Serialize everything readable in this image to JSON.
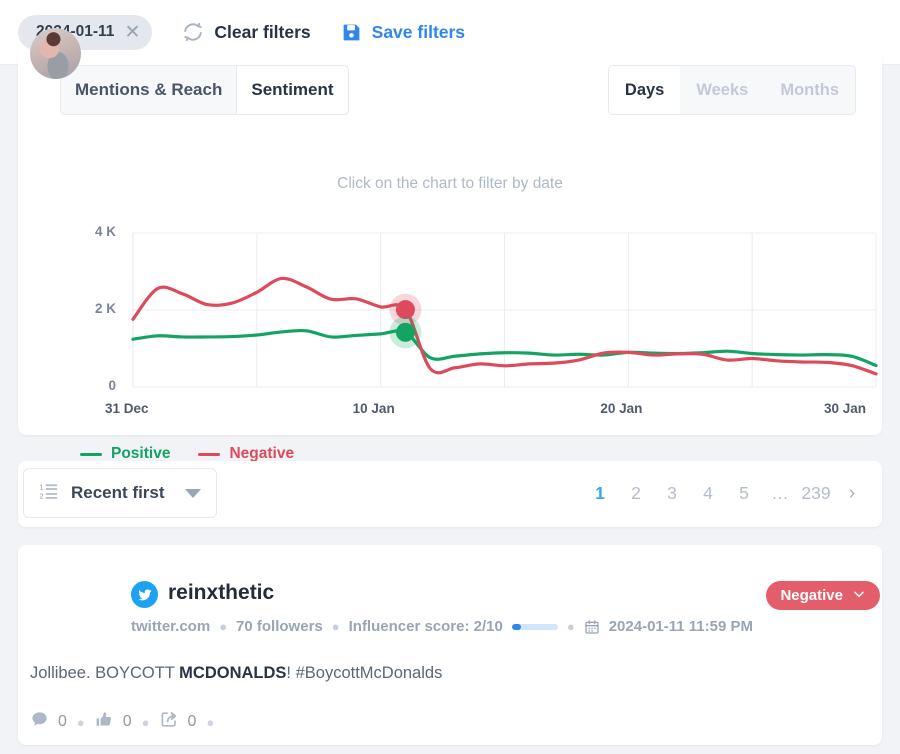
{
  "topbar": {
    "date_chip": "2024-01-11",
    "clear_filters": "Clear filters",
    "save_filters": "Save filters",
    "refresh_icon": "refresh-icon",
    "save_icon": "save-floppy-icon",
    "close_icon": "close-icon"
  },
  "chart_card": {
    "tabs": [
      {
        "label": "Mentions & Reach",
        "active": false
      },
      {
        "label": "Sentiment",
        "active": true
      }
    ],
    "granularity": [
      {
        "label": "Days",
        "active": true
      },
      {
        "label": "Weeks",
        "active": false
      },
      {
        "label": "Months",
        "active": false
      }
    ],
    "hint": "Click on the chart to filter by date"
  },
  "chart_data": {
    "type": "line",
    "title": "",
    "xlabel": "",
    "ylabel": "",
    "ylim": [
      0,
      4000
    ],
    "ytick_labels": [
      "4 K",
      "2 K",
      "0"
    ],
    "ytick_values": [
      4000,
      2000,
      0
    ],
    "xtick_labels": [
      "31 Dec",
      "10 Jan",
      "20 Jan",
      "30 Jan"
    ],
    "xtick_index": [
      0,
      10,
      20,
      30
    ],
    "grid": true,
    "legend_position": "bottom-left",
    "selected_x": "2024-01-11",
    "selected_index": 11,
    "x": [
      "31 Dec",
      "1 Jan",
      "2 Jan",
      "3 Jan",
      "4 Jan",
      "5 Jan",
      "6 Jan",
      "7 Jan",
      "8 Jan",
      "9 Jan",
      "10 Jan",
      "11 Jan",
      "12 Jan",
      "13 Jan",
      "14 Jan",
      "15 Jan",
      "16 Jan",
      "17 Jan",
      "18 Jan",
      "19 Jan",
      "20 Jan",
      "21 Jan",
      "22 Jan",
      "23 Jan",
      "24 Jan",
      "25 Jan",
      "26 Jan",
      "27 Jan",
      "28 Jan",
      "29 Jan",
      "30 Jan"
    ],
    "series": [
      {
        "name": "Positive",
        "color": "#13a463",
        "values": [
          1240,
          1330,
          1300,
          1300,
          1310,
          1350,
          1430,
          1460,
          1300,
          1340,
          1380,
          1420,
          760,
          800,
          860,
          890,
          880,
          830,
          850,
          830,
          900,
          880,
          870,
          890,
          930,
          870,
          840,
          830,
          840,
          800,
          560
        ]
      },
      {
        "name": "Negative",
        "color": "#dc4a5c",
        "values": [
          1760,
          2560,
          2420,
          2140,
          2180,
          2460,
          2820,
          2600,
          2280,
          2290,
          2080,
          2010,
          480,
          500,
          600,
          550,
          600,
          620,
          700,
          880,
          900,
          830,
          860,
          850,
          700,
          740,
          680,
          650,
          640,
          560,
          340
        ]
      }
    ],
    "markers": [
      {
        "series": "Negative",
        "x": "11 Jan",
        "y": 2010,
        "color": "#dc4a5c"
      },
      {
        "series": "Positive",
        "x": "11 Jan",
        "y": 1420,
        "color": "#13a463"
      }
    ]
  },
  "list_toolbar": {
    "sort_label": "Recent first",
    "sort_icon": "sort-list-icon",
    "caret_icon": "chevron-down-icon",
    "pagination": {
      "pages": [
        "1",
        "2",
        "3",
        "4",
        "5",
        "…",
        "239"
      ],
      "active": "1",
      "next_icon": "chevron-right-icon"
    }
  },
  "mention": {
    "avatar": "user-avatar",
    "network_icon": "twitter-icon",
    "username": "reinxthetic",
    "source": "twitter.com",
    "followers": "70 followers",
    "influencer_score": "Influencer score: 2/10",
    "influencer_score_pct": 20,
    "calendar_icon": "calendar-icon",
    "date": "2024-01-11 11:59 PM",
    "sentiment_badge": "Negative",
    "sentiment_color": "#e35d6a",
    "badge_caret_icon": "chevron-down-icon",
    "text_before": "Jollibee. BOYCOTT ",
    "text_bold": "MCDONALDS",
    "text_after": "! #BoycottMcDonalds",
    "engagement": [
      {
        "icon": "comment-icon",
        "count": "0"
      },
      {
        "icon": "thumbs-up-icon",
        "count": "0"
      },
      {
        "icon": "share-icon",
        "count": "0"
      }
    ]
  }
}
